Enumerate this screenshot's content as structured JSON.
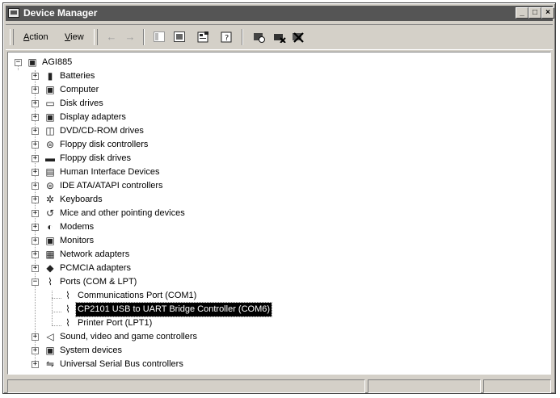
{
  "window": {
    "title": "Device Manager",
    "buttons": {
      "minimize": "_",
      "maximize": "□",
      "close": "×"
    }
  },
  "menu": {
    "action": {
      "accel": "A",
      "rest": "ction"
    },
    "view": {
      "accel": "V",
      "rest": "iew"
    }
  },
  "toolbar": {
    "back": "←",
    "forward": "→",
    "back_enabled": false,
    "forward_enabled": false
  },
  "tree": {
    "root": {
      "label": "AGI885",
      "icon": "computer-icon",
      "expander": "−"
    },
    "categories": [
      {
        "label": "Batteries",
        "icon": "battery-icon",
        "expander": "+"
      },
      {
        "label": "Computer",
        "icon": "computer-icon",
        "expander": "+"
      },
      {
        "label": "Disk drives",
        "icon": "disk-drive-icon",
        "expander": "+"
      },
      {
        "label": "Display adapters",
        "icon": "display-adapter-icon",
        "expander": "+"
      },
      {
        "label": "DVD/CD-ROM drives",
        "icon": "cdrom-icon",
        "expander": "+"
      },
      {
        "label": "Floppy disk controllers",
        "icon": "floppy-controller-icon",
        "expander": "+"
      },
      {
        "label": "Floppy disk drives",
        "icon": "floppy-drive-icon",
        "expander": "+"
      },
      {
        "label": "Human Interface Devices",
        "icon": "hid-icon",
        "expander": "+"
      },
      {
        "label": "IDE ATA/ATAPI controllers",
        "icon": "ide-controller-icon",
        "expander": "+"
      },
      {
        "label": "Keyboards",
        "icon": "keyboard-icon",
        "expander": "+"
      },
      {
        "label": "Mice and other pointing devices",
        "icon": "mouse-icon",
        "expander": "+"
      },
      {
        "label": "Modems",
        "icon": "modem-icon",
        "expander": "+"
      },
      {
        "label": "Monitors",
        "icon": "monitor-icon",
        "expander": "+"
      },
      {
        "label": "Network adapters",
        "icon": "network-adapter-icon",
        "expander": "+"
      },
      {
        "label": "PCMCIA adapters",
        "icon": "pcmcia-icon",
        "expander": "+"
      },
      {
        "label": "Ports (COM & LPT)",
        "icon": "port-icon",
        "expander": "−"
      },
      {
        "label": "Sound, video and game controllers",
        "icon": "sound-icon",
        "expander": "+"
      },
      {
        "label": "System devices",
        "icon": "system-device-icon",
        "expander": "+"
      },
      {
        "label": "Universal Serial Bus controllers",
        "icon": "usb-icon",
        "expander": "+"
      }
    ],
    "ports_children": [
      {
        "label": "Communications Port (COM1)",
        "icon": "port-icon",
        "selected": false
      },
      {
        "label": "CP2101 USB to UART Bridge Controller (COM6)",
        "icon": "port-icon",
        "selected": true
      },
      {
        "label": "Printer Port (LPT1)",
        "icon": "port-icon",
        "selected": false
      }
    ]
  },
  "statusbar": {
    "panels": [
      "",
      "",
      ""
    ]
  },
  "colors": {
    "titlebar": "#555555",
    "selection": "#000000",
    "face": "#d4d0c8"
  }
}
